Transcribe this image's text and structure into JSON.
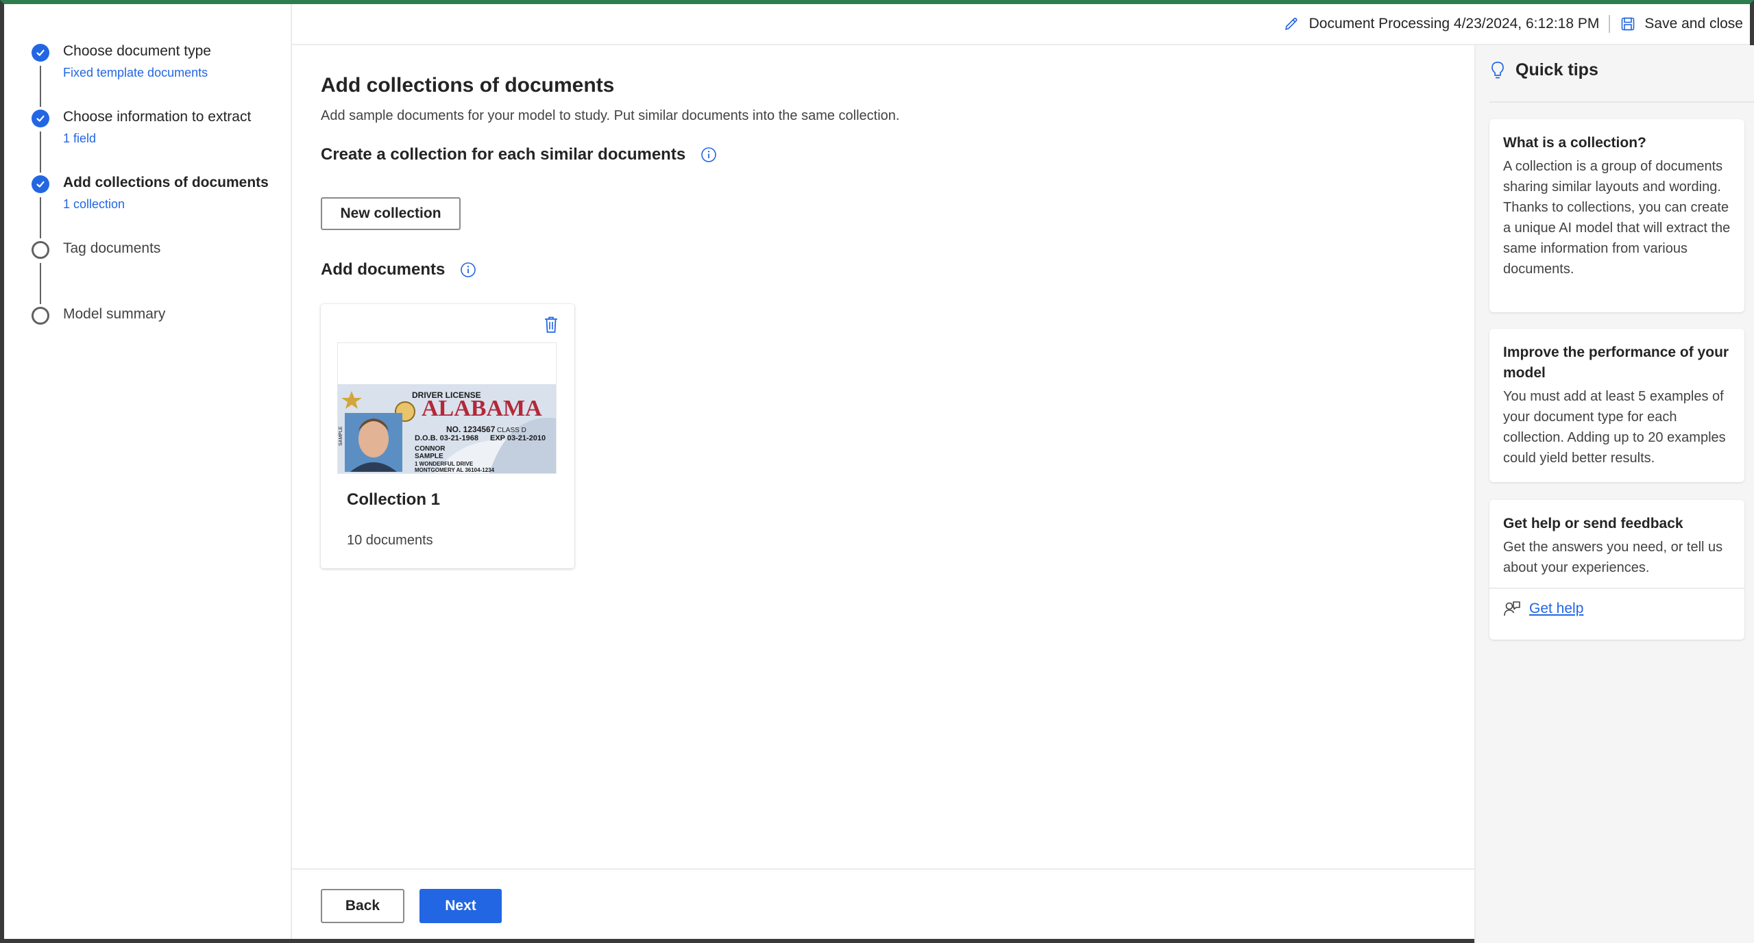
{
  "steps": [
    {
      "title": "Choose document type",
      "subtitle": "Fixed template documents",
      "state": "done"
    },
    {
      "title": "Choose information to extract",
      "subtitle": "1 field",
      "state": "done"
    },
    {
      "title": "Add collections of documents",
      "subtitle": "1 collection",
      "state": "current"
    },
    {
      "title": "Tag documents",
      "subtitle": "",
      "state": "todo"
    },
    {
      "title": "Model summary",
      "subtitle": "",
      "state": "todo"
    }
  ],
  "topbar": {
    "document_title": "Document Processing 4/23/2024, 6:12:18 PM",
    "save_label": "Save and close"
  },
  "main": {
    "title": "Add collections of documents",
    "description": "Add sample documents for your model to study. Put similar documents into the same collection.",
    "create_heading": "Create a collection for each similar documents",
    "new_collection_label": "New collection",
    "add_documents_heading": "Add documents",
    "collections": [
      {
        "title": "Collection 1",
        "count": "10 documents",
        "thumbnail": {
          "header": "DRIVER LICENSE",
          "state": "ALABAMA",
          "no": "NO. 1234567",
          "class": "CLASS D",
          "dob": "D.O.B. 03-21-1968",
          "exp": "EXP 03-21-2010",
          "name1": "CONNOR",
          "name2": "SAMPLE",
          "addr1": "1 WONDERFUL DRIVE",
          "addr2": "MONTGOMERY AL 36104-1234",
          "side": "SAMPLE"
        }
      }
    ]
  },
  "footer": {
    "back_label": "Back",
    "next_label": "Next"
  },
  "tips": {
    "title": "Quick tips",
    "cards": [
      {
        "title": "What is a collection?",
        "body": "A collection is a group of documents sharing similar layouts and wording. Thanks to collections, you can create a unique AI model that will extract the same information from various documents."
      },
      {
        "title": "Improve the performance of your model",
        "body": "You must add at least 5 examples of your document type for each collection. Adding up to 20 examples could yield better results."
      },
      {
        "title": "Get help or send feedback",
        "body": "Get the answers you need, or tell us about your experiences.",
        "link": "Get help"
      }
    ]
  },
  "colors": {
    "accent": "#2266e3",
    "frame_top": "#2e7d4f"
  }
}
